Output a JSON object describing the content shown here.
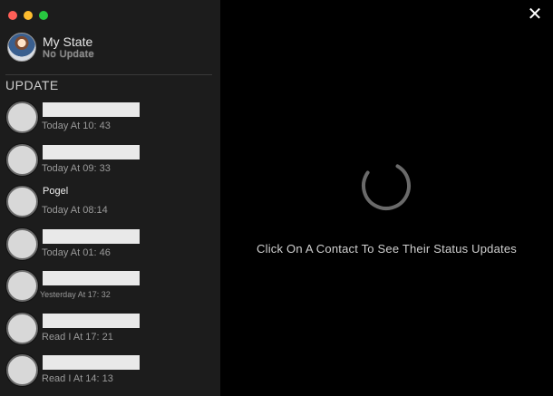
{
  "window": {
    "traffic_lights": {
      "close": "#ff5f57",
      "minimize": "#febc2e",
      "zoom": "#28c840"
    }
  },
  "sidebar": {
    "my_state": {
      "title": "My State",
      "subtitle": "No Update"
    },
    "section_label": "UPDATE",
    "contacts": [
      {
        "name": "",
        "time": "Today At 10: 43"
      },
      {
        "name": "",
        "time": "Today At 09: 33"
      },
      {
        "name": "Pogel",
        "time": "Today At 08:14"
      },
      {
        "name": "",
        "time": "Today At 01: 46"
      },
      {
        "name": "",
        "time": "Yesterday At 17: 32"
      },
      {
        "name": "",
        "time": "Read I At 17: 21"
      },
      {
        "name": "",
        "time": "Read I At 14: 13"
      }
    ]
  },
  "main": {
    "close_icon": "close-icon",
    "spinner_icon": "loading-spinner-icon",
    "empty_message": "Click On A Contact To See Their Status Updates"
  },
  "colors": {
    "sidebar_bg": "#1c1c1c",
    "main_bg": "#000000",
    "text_primary": "#e6e6e6",
    "text_secondary": "#9a9a9a"
  }
}
